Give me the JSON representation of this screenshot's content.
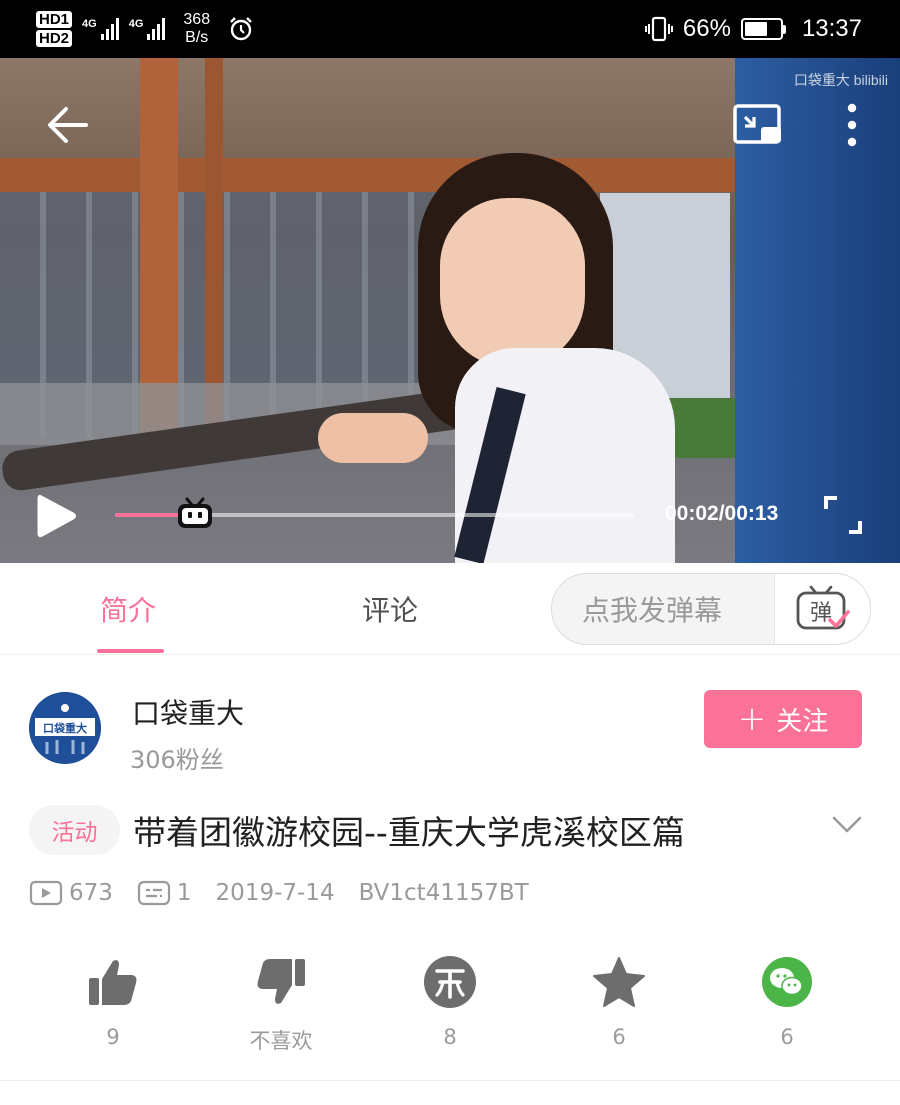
{
  "status_bar": {
    "hd1": "HD1",
    "hd2": "HD2",
    "net1": "4G",
    "net2": "4G",
    "speed_value": "368",
    "speed_unit": "B/s",
    "battery": "66%",
    "battery_level": 0.66,
    "time": "13:37",
    "icons": [
      "alarm-icon",
      "vibrate-icon",
      "battery-icon"
    ]
  },
  "player": {
    "watermark": "口袋重大 bilibili",
    "time": "00:02/00:13",
    "progress": 0.154,
    "accent": "#fb7299",
    "icons": [
      "back-arrow-icon",
      "cast-icon",
      "more-icon",
      "play-icon",
      "tv-mascot-icon",
      "fullscreen-icon"
    ]
  },
  "tabs": {
    "items": [
      {
        "label": "简介",
        "active": true
      },
      {
        "label": "评论",
        "active": false
      }
    ],
    "danmaku_placeholder": "点我发弹幕",
    "danmaku_icon_char": "弹"
  },
  "uploader": {
    "avatar_text": "口袋重大",
    "name": "口袋重大",
    "fans": "306粉丝",
    "follow_label": "关注",
    "follow_plus": "+"
  },
  "video": {
    "tag": "活动",
    "title": "带着团徽游校园--重庆大学虎溪校区篇",
    "views": "673",
    "danmaku_count": "1",
    "date": "2019-7-14",
    "bvid": "BV1ct41157BT"
  },
  "actions": [
    {
      "name": "like",
      "label": "9",
      "icon": "thumbs-up-icon"
    },
    {
      "name": "dislike",
      "label": "不喜欢",
      "icon": "thumbs-down-icon"
    },
    {
      "name": "coin",
      "label": "8",
      "icon": "coin-icon"
    },
    {
      "name": "favorite",
      "label": "6",
      "icon": "star-icon"
    },
    {
      "name": "share",
      "label": "6",
      "icon": "wechat-icon"
    }
  ],
  "colors": {
    "accent": "#fb7299",
    "icon_gray": "#6d6d6d",
    "wechat_green": "#4cb548"
  }
}
